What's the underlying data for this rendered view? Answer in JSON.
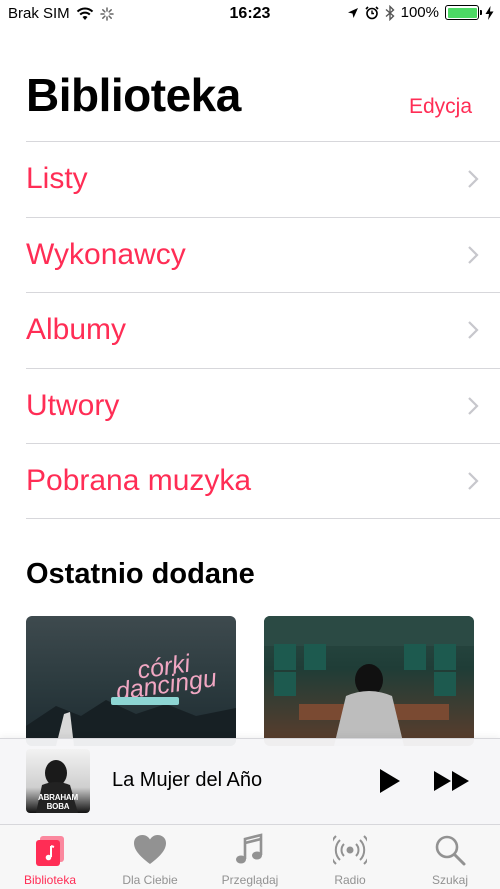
{
  "status_bar": {
    "carrier": "Brak SIM",
    "time": "16:23",
    "battery": "100%",
    "icons": [
      "wifi-icon",
      "spinner-icon",
      "location-icon",
      "alarm-icon",
      "bluetooth-icon",
      "battery-icon",
      "charging-icon"
    ]
  },
  "header": {
    "title": "Biblioteka",
    "edit": "Edycja"
  },
  "nav": {
    "items": [
      {
        "label": "Listy"
      },
      {
        "label": "Wykonawcy"
      },
      {
        "label": "Albumy"
      },
      {
        "label": "Utwory"
      },
      {
        "label": "Pobrana muzyka"
      }
    ]
  },
  "recent": {
    "title": "Ostatnio dodane",
    "album1_logo": "córki dancingu"
  },
  "mini_player": {
    "title": "La Mujer del Año",
    "art_text": "ABRAHAM BOBA"
  },
  "tabs": [
    {
      "label": "Biblioteka",
      "icon": "library-icon",
      "active": true
    },
    {
      "label": "Dla Ciebie",
      "icon": "heart-icon",
      "active": false
    },
    {
      "label": "Przeglądaj",
      "icon": "note-icon",
      "active": false
    },
    {
      "label": "Radio",
      "icon": "radio-icon",
      "active": false
    },
    {
      "label": "Szukaj",
      "icon": "search-icon",
      "active": false
    }
  ],
  "colors": {
    "accent": "#ff2d55",
    "battery": "#4cd964",
    "inactive_tab": "#929292"
  }
}
